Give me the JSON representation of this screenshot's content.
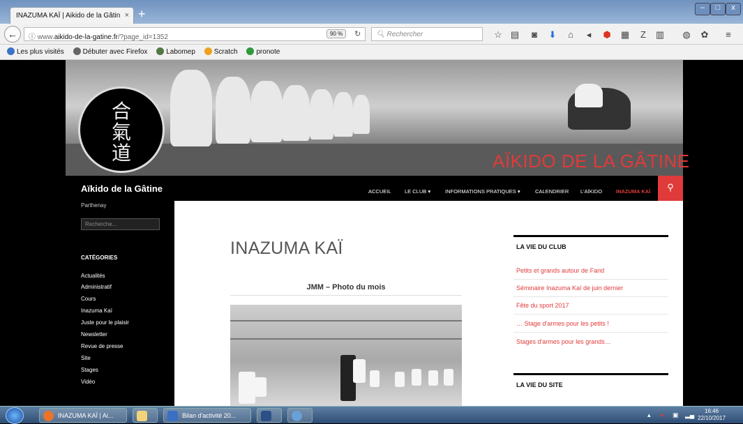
{
  "browser": {
    "tab_title": "INAZUMA KAÏ | Aikido de la Gâtin",
    "tab_close": "×",
    "new_tab": "+",
    "url_prefix": "www.",
    "url_domain": "aikido-de-la-gatine.fr",
    "url_path": "/?page_id=1352",
    "zoom": "90 %",
    "search_placeholder": "Rechercher",
    "window_buttons": [
      "–",
      "□",
      "x"
    ],
    "bookmarks": [
      {
        "label": "Les plus visités",
        "color": "#3b74c7"
      },
      {
        "label": "Débuter avec Firefox",
        "color": "#666666"
      },
      {
        "label": "Labomep",
        "color": "#557744"
      },
      {
        "label": "Scratch",
        "color": "#f0a020"
      },
      {
        "label": "pronote",
        "color": "#2e9a3a"
      }
    ]
  },
  "site": {
    "header_title": "AÏKIDO DE LA GÂTINE",
    "logo_kanji": "合\n氣\n道",
    "name": "Aïkido de la Gâtine",
    "tagline": "Parthenay",
    "search_placeholder": "Recherche...",
    "nav": [
      {
        "label": "ACCUEIL"
      },
      {
        "label": "LE CLUB ▾"
      },
      {
        "label": "INFORMATIONS PRATIQUES ▾"
      },
      {
        "label": "CALENDRIER"
      },
      {
        "label": "L'AÏKIDO"
      },
      {
        "label": "INAZUMA KAÏ"
      }
    ],
    "categories_heading": "CATÉGORIES",
    "categories": [
      "Actualités",
      "Administratif",
      "Cours",
      "Inazuma Kaï",
      "Juste pour le plaisir",
      "Newsletter",
      "Revue de presse",
      "Site",
      "Stages",
      "Vidéo"
    ],
    "accent": "#e13a3a"
  },
  "main": {
    "page_title": "INAZUMA KAÏ",
    "post_title": "JMM – Photo du mois"
  },
  "widgets": [
    {
      "heading": "LA VIE DU CLUB",
      "links": [
        "Petits et grands autour de Farid",
        "Séminaire Inazuma Kaï de juin dernier",
        "Fête du sport 2017",
        "… Stage d'armes pour les petits !",
        "Stages d'armes pour les grands…"
      ]
    },
    {
      "heading": "LA VIE DU SITE",
      "links": []
    }
  ],
  "taskbar": {
    "items": [
      {
        "label": "INAZUMA KAÏ | Ai...",
        "icon_color": "#e8742a"
      },
      {
        "label": "",
        "icon_color": "#f2d37a"
      },
      {
        "label": "Bilan d'activité 20...",
        "icon_color": "#3a6fc4"
      },
      {
        "label": "",
        "icon_color": "#2c4f86"
      },
      {
        "label": "",
        "icon_color": "#6aa0d8"
      }
    ],
    "time": "16:46",
    "date": "22/10/2017"
  }
}
